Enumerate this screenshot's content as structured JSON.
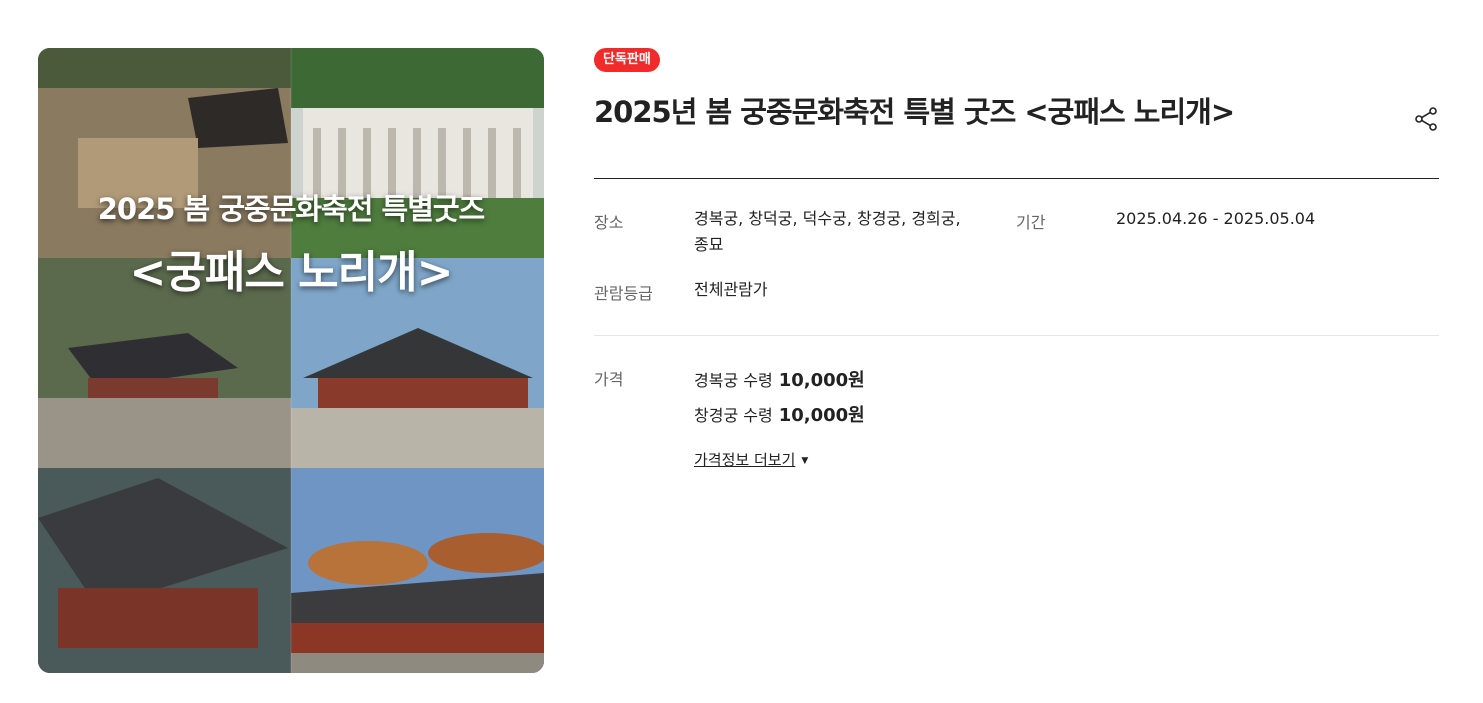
{
  "poster": {
    "line1": "2025 봄 궁중문화축전 특별굿즈",
    "line2": "<궁패스 노리개>"
  },
  "badge": "단독판매",
  "title": "2025년 봄 궁중문화축전 특별 굿즈 <궁패스 노리개>",
  "share_icon": "share-icon",
  "meta": {
    "place_label": "장소",
    "place_line1": "경복궁, 창덕궁, 덕수궁, 창경궁, 경희궁,",
    "place_line2": "종묘",
    "period_label": "기간",
    "period_value": "2025.04.26 - 2025.05.04",
    "rating_label": "관람등급",
    "rating_value": "전체관람가"
  },
  "price": {
    "label": "가격",
    "items": [
      {
        "name": "경복궁 수령",
        "amount": "10,000원"
      },
      {
        "name": "창경궁 수령",
        "amount": "10,000원"
      }
    ],
    "more_label": "가격정보 더보기",
    "more_icon": "caret-down-icon"
  },
  "colors": {
    "badge": "#f12a2a",
    "text": "#222222",
    "label": "#666666"
  }
}
